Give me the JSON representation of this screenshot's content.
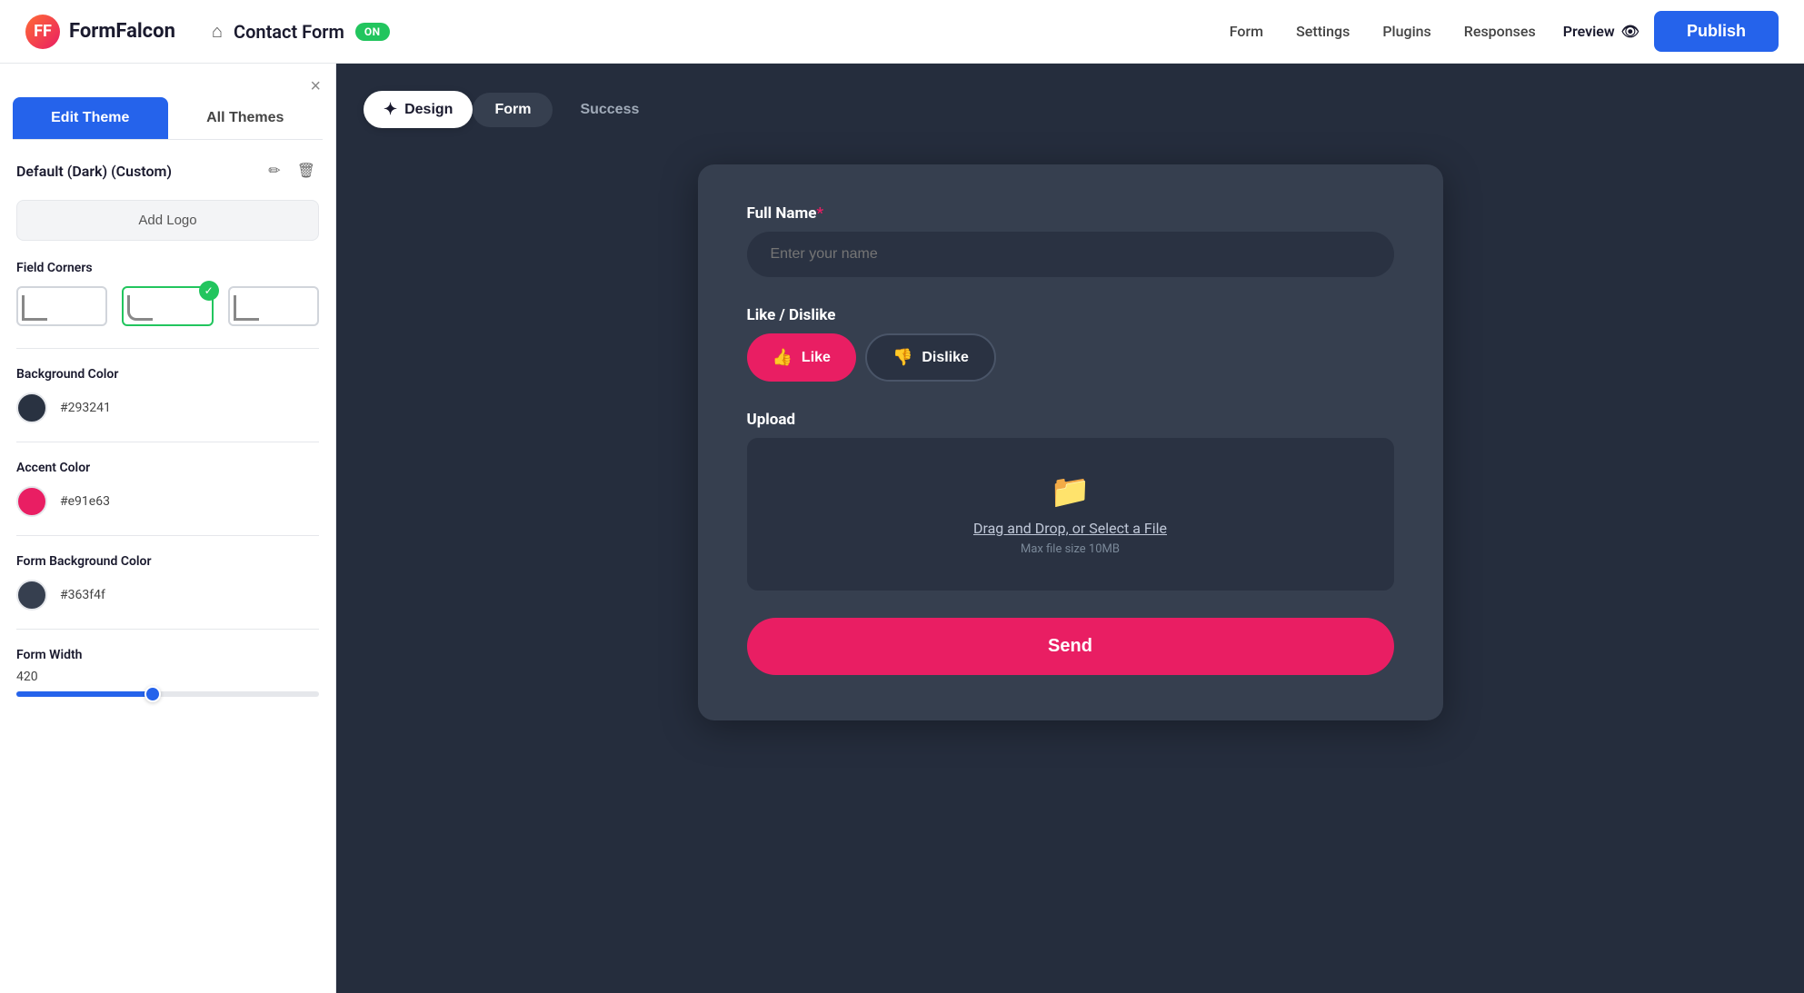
{
  "brand": {
    "logo_symbol": "FF",
    "name": "FormFalcon"
  },
  "topnav": {
    "home_icon": "⌂",
    "form_title": "Contact Form",
    "on_badge": "ON",
    "nav_links": [
      "Form",
      "Settings",
      "Plugins",
      "Responses"
    ],
    "preview_label": "Preview",
    "preview_icon": "👁",
    "publish_label": "Publish"
  },
  "sidebar": {
    "close_icon": "×",
    "tab_edit": "Edit Theme",
    "tab_all": "All Themes",
    "theme_name": "Default (Dark) (Custom)",
    "edit_icon": "✏",
    "delete_icon": "🗑",
    "add_logo_label": "Add Logo",
    "field_corners_label": "Field Corners",
    "corners": [
      {
        "id": "sharp",
        "selected": false
      },
      {
        "id": "round",
        "selected": true
      },
      {
        "id": "sharp2",
        "selected": false
      }
    ],
    "bg_color_label": "Background Color",
    "bg_color_hex": "#293241",
    "bg_color_value": "#293241",
    "accent_color_label": "Accent Color",
    "accent_color_hex": "#e91e63",
    "accent_color_value": "#e91e63",
    "form_bg_color_label": "Form Background Color",
    "form_bg_color_hex": "#363f4f",
    "form_bg_color_value": "#363f4f",
    "form_width_label": "Form Width",
    "form_width_value": "420",
    "slider_percent": 45
  },
  "canvas": {
    "design_btn_icon": "✦",
    "design_btn_label": "Design",
    "tab_form": "Form",
    "tab_success": "Success"
  },
  "form": {
    "full_name_label": "Full Name",
    "full_name_required": "*",
    "full_name_placeholder": "Enter your name",
    "like_dislike_label": "Like / Dislike",
    "like_btn_label": "Like",
    "dislike_btn_label": "Dislike",
    "like_icon": "👍",
    "dislike_icon": "👎",
    "upload_label": "Upload",
    "upload_icon": "📁",
    "upload_main_text_1": "Drag and Drop, or ",
    "upload_main_text_link": "Select a File",
    "upload_sub_text": "Max file size 10MB",
    "send_btn_label": "Send"
  }
}
